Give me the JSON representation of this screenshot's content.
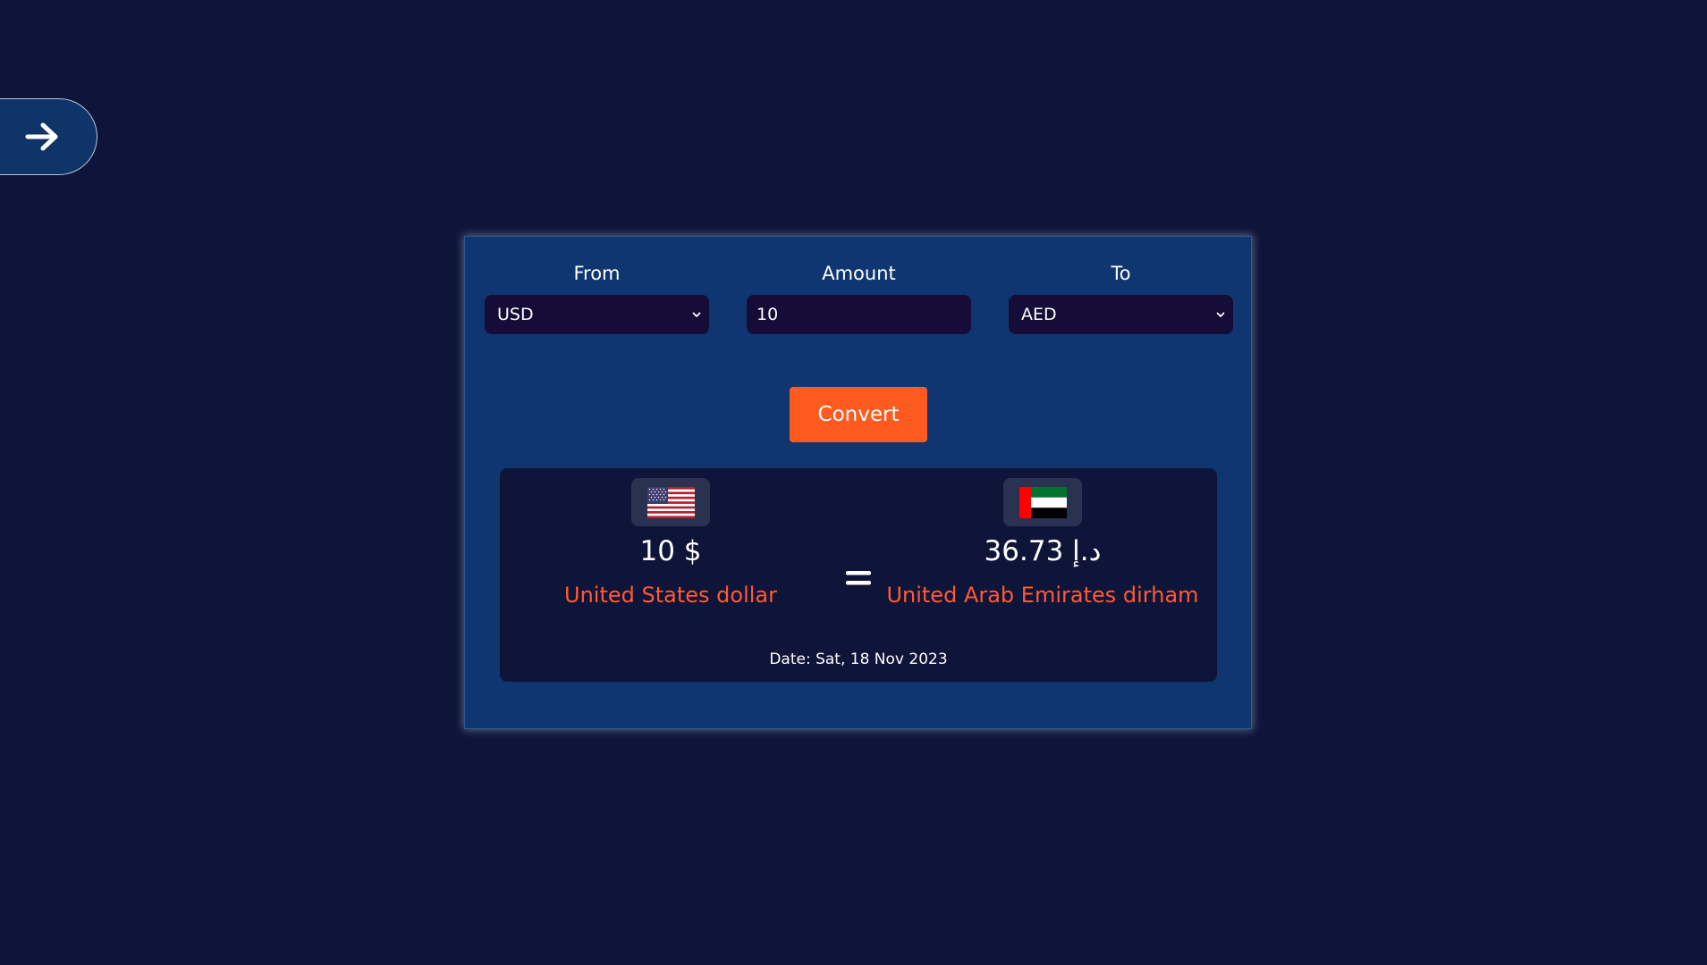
{
  "nav": {
    "back_icon": "arrow-right-icon"
  },
  "converter": {
    "from": {
      "label": "From",
      "selected": "USD"
    },
    "amount": {
      "label": "Amount",
      "value": "10"
    },
    "to": {
      "label": "To",
      "selected": "AED"
    },
    "convert_label": "Convert"
  },
  "result": {
    "from_flag": "us-flag-icon",
    "to_flag": "uae-flag-icon",
    "from_amount": "10 $",
    "to_amount": "36.73 د.إ",
    "from_name": "United States dollar",
    "to_name": "United Arab Emirates dirham",
    "equals_icon": "equals-icon",
    "date": "Date: Sat, 18 Nov 2023"
  },
  "colors": {
    "background": "#0e1539",
    "card": "#0f3670",
    "panel": "#0f1439",
    "accent": "#ff5a1f",
    "currency_name": "#ff5a36"
  }
}
